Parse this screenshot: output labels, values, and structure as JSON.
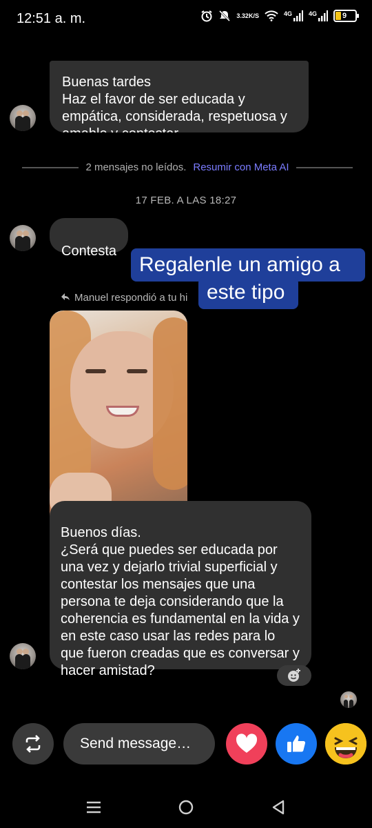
{
  "status_bar": {
    "time": "12:51 a. m.",
    "net_speed_value": "3.32",
    "net_speed_unit": "K/S",
    "sim1": "4G",
    "sim2": "4G",
    "battery": "9",
    "icons": [
      "alarm-icon",
      "mute-icon",
      "wifi-icon",
      "signal-icon",
      "signal-icon",
      "battery-icon"
    ]
  },
  "messages": [
    {
      "sender": "them",
      "text": "Buenas tardes\nHaz el favor de ser educada y empática, considerada, respetuosa y amable y contestar"
    }
  ],
  "unread_divider": {
    "text": "2 mensajes no leídos.",
    "link": "Resumir con Meta AI"
  },
  "date_separator": "17 FEB. A LAS 18:27",
  "contesta": {
    "sender": "them",
    "text": "Contesta"
  },
  "sticker_overlay": {
    "line1": "Regalenle un amigo a",
    "line2": "este tipo"
  },
  "reply_note": "Manuel respondió a tu hi",
  "long_message": {
    "sender": "them",
    "text": "Buenos días.\n¿Será que puedes ser educada por una vez y dejarlo trivial superficial y contestar los mensajes que una persona te deja considerando que la coherencia es fundamental en la vida y en este caso usar las redes para lo que fueron creadas que es conversar y hacer amistad?"
  },
  "composer": {
    "placeholder": "Send message…"
  },
  "colors": {
    "background": "#000000",
    "bubble": "#303030",
    "meta_ai_link": "#7b7cff",
    "sticker": "#1f3f9a",
    "heart": "#f0405a",
    "like": "#1877f2",
    "emoji": "#f6c21e"
  }
}
